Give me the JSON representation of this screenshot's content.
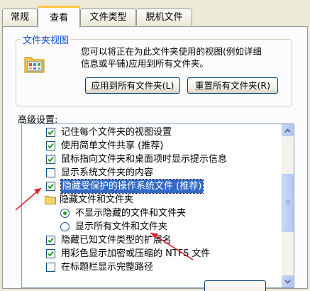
{
  "tabs": [
    {
      "label": "常规"
    },
    {
      "label": "查看"
    },
    {
      "label": "文件类型"
    },
    {
      "label": "脱机文件"
    }
  ],
  "folder_views": {
    "title": "文件夹视图",
    "desc_line1": "您可以将正在为此文件夹使用的视图(例如详细",
    "desc_line2": "信息或平铺)应用到所有文件夹。",
    "apply_label": "应用到所有文件夹(L)",
    "reset_label": "重置所有文件夹(R)"
  },
  "advanced": {
    "label": "高级设置:",
    "items": [
      {
        "kind": "checkbox",
        "checked": true,
        "text": "记住每个文件夹的视图设置"
      },
      {
        "kind": "checkbox",
        "checked": true,
        "text": "使用简单文件共享 (推荐)"
      },
      {
        "kind": "checkbox",
        "checked": true,
        "text": "鼠标指向文件夹和桌面项时显示提示信息"
      },
      {
        "kind": "checkbox",
        "checked": false,
        "text": "显示系统文件夹的内容"
      },
      {
        "kind": "checkbox",
        "checked": true,
        "selected": true,
        "text": "隐藏受保护的操作系统文件 (推荐)"
      },
      {
        "kind": "folder",
        "text": "隐藏文件和文件夹"
      },
      {
        "kind": "radio",
        "checked": true,
        "text": "不显示隐藏的文件和文件夹"
      },
      {
        "kind": "radio",
        "checked": false,
        "text": "显示所有文件和文件夹"
      },
      {
        "kind": "checkbox",
        "checked": true,
        "text": "隐藏已知文件类型的扩展名"
      },
      {
        "kind": "checkbox",
        "checked": true,
        "text": "用彩色显示加密或压缩的 NTFS 文件"
      },
      {
        "kind": "checkbox",
        "checked": false,
        "text": "在标题栏显示完整路径"
      }
    ]
  },
  "colors": {
    "accent": "#316ac5",
    "annotation_arrow": "#e0202a",
    "check": "#21a121"
  }
}
